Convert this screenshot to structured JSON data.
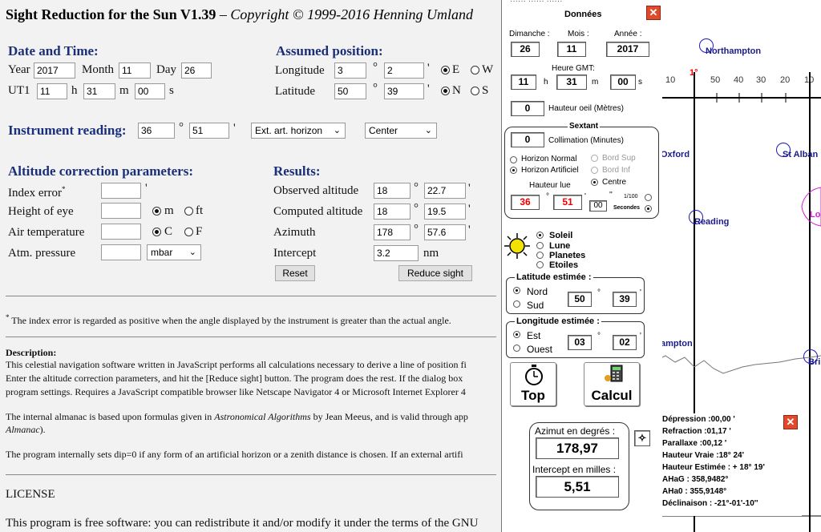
{
  "page": {
    "title_bold": "Sight Reduction for the Sun V1.39",
    "title_italic": " – Copyright © 1999-2016 Henning Umland",
    "date_section": "Date and Time:",
    "year_label": "Year",
    "year": "2017",
    "month_label": "Month",
    "month": "11",
    "day_label": "Day",
    "day": "26",
    "ut1_label": "UT1",
    "ut1_h": "11",
    "h_label": "h",
    "ut1_m": "31",
    "m_label": "m",
    "ut1_s": "00",
    "s_label": "s",
    "assumed_section": "Assumed position:",
    "lon_label": "Longitude",
    "lon_deg": "3",
    "lon_min": "2",
    "east": "E",
    "west": "W",
    "lat_label": "Latitude",
    "lat_deg": "50",
    "lat_min": "39",
    "north": "N",
    "south": "S",
    "deg_sym": "°",
    "min_sym": "'",
    "instrument_label": "Instrument reading:",
    "inst_deg": "36",
    "inst_min": "51",
    "horizon_select": "Ext. art. horizon",
    "limb_select": "Center",
    "corr_section": "Altitude correction parameters:",
    "index_error_label": "Index error",
    "index_star": "*",
    "height_eye_label": "Height of eye",
    "unit_m": "m",
    "unit_ft": "ft",
    "air_temp_label": "Air temperature",
    "unit_c": "C",
    "unit_f": "F",
    "pressure_label": "Atm. pressure",
    "pressure_unit": "mbar",
    "results_section": "Results:",
    "obs_alt_label": "Observed altitude",
    "obs_deg": "18",
    "obs_min": "22.7",
    "comp_alt_label": "Computed altitude",
    "comp_deg": "18",
    "comp_min": "19.5",
    "azimuth_label": "Azimuth",
    "az_deg": "178",
    "az_min": "57.6",
    "intercept_label": "Intercept",
    "intercept": "3.2",
    "intercept_unit": "nm",
    "reset_button": "Reset",
    "reduce_button": "Reduce sight",
    "footnote": "The index error is regarded as positive when the angle displayed by the instrument is greater than the actual angle.",
    "desc_heading": "Description:",
    "desc_lines": [
      "This celestial navigation software written in JavaScript performs all calculations necessary to derive a line of position fi",
      "Enter the altitude correction parameters, and hit the [Reduce sight] button. The program does the rest. If the dialog box",
      "program settings. Requires a JavaScript compatible browser like Netscape Navigator 4 or Microsoft Internet Explorer 4"
    ],
    "almanac_line1a": "The internal almanac is based upon formulas given in ",
    "almanac_line1b": "Astronomical Algorithms",
    "almanac_line1c": " by Jean Meeus, and is valid through app",
    "almanac_line2a": "Almanac",
    "almanac_line2b": ").",
    "dip_line": "The program internally sets dip=0 if any form of an artificial horizon or a zenith distance is chosen. If an external artifi",
    "license_heading": "LICENSE",
    "license_line": "This program is free software: you can redistribute it and/or modify it under the terms of the GNU"
  },
  "app": {
    "menu_fragment": "······ ······ ······",
    "title": "Données",
    "close": "✕",
    "weekday_label": "Dimanche :",
    "weekday_value": "26",
    "month_label": "Mois :",
    "month_value": "11",
    "year_label": "Année :",
    "year_value": "2017",
    "gmt_label": "Heure GMT:",
    "gmt_h": "11",
    "h": "h",
    "gmt_m": "31",
    "m": "m",
    "gmt_s": "00",
    "s": "s",
    "eye_value": "0",
    "eye_label": "Hauteur oeil (Mètres)",
    "sextant_title": "Sextant",
    "collim_value": "0",
    "collim_label": "Collimation (Minutes)",
    "horizon_normal": "Horizon Normal",
    "horizon_artificiel": "Horizon Artificiel",
    "bord_sup": "Bord Sup",
    "bord_inf": "Bord Inf",
    "centre": "Centre",
    "hauteur_lue": "Hauteur lue",
    "hl_deg": "36",
    "hl_min": "51",
    "hl_sec": "00",
    "deg_sym": "°",
    "min_sym": "'",
    "sec_sym": "''",
    "hundredths": "1/100",
    "secondes": "Secondes",
    "soleil": "Soleil",
    "lune": "Lune",
    "planetes": "Planetes",
    "etoiles": "Etoiles",
    "lat_title": "Latitude  estimée :",
    "nord": "Nord",
    "sud": "Sud",
    "lat_deg": "50",
    "lat_min": "39",
    "lon_title": "Longitude  estimée :",
    "est": "Est",
    "ouest": "Ouest",
    "lon_deg": "03",
    "lon_min": "02",
    "top_button": "Top",
    "calcul_button": "Calcul",
    "azimut_label": "Azimut en degrés :",
    "azimut_value": "178,97",
    "intercept_label": "Intercept en milles :",
    "intercept_value": "5,51"
  },
  "info": {
    "close": "✕",
    "depression": "Dépression :00,00 '",
    "refraction": "Refraction :01,17 '",
    "parallaxe": "Parallaxe :00,12 '",
    "hauteur_vraie": "Hauteur Vraie :18° 24'",
    "hauteur_estimee": "Hauteur Estimée : + 18° 19'",
    "ahag": "AHaG : 358,9482°",
    "aha0": "AHa0 : 355,9148°",
    "declinaison": "Déclinaison : -21°-01'-10''"
  },
  "map": {
    "northampton": "Northampton",
    "oxford": "Oxford",
    "st_albans": "St Alban",
    "reading": "Reading",
    "lo": "Lo",
    "hampton": "ampton",
    "brighton": "Bri",
    "scale_left": "10",
    "scale_marker": "1°",
    "scale_values": [
      "50",
      "40",
      "30",
      "20",
      "10"
    ]
  }
}
